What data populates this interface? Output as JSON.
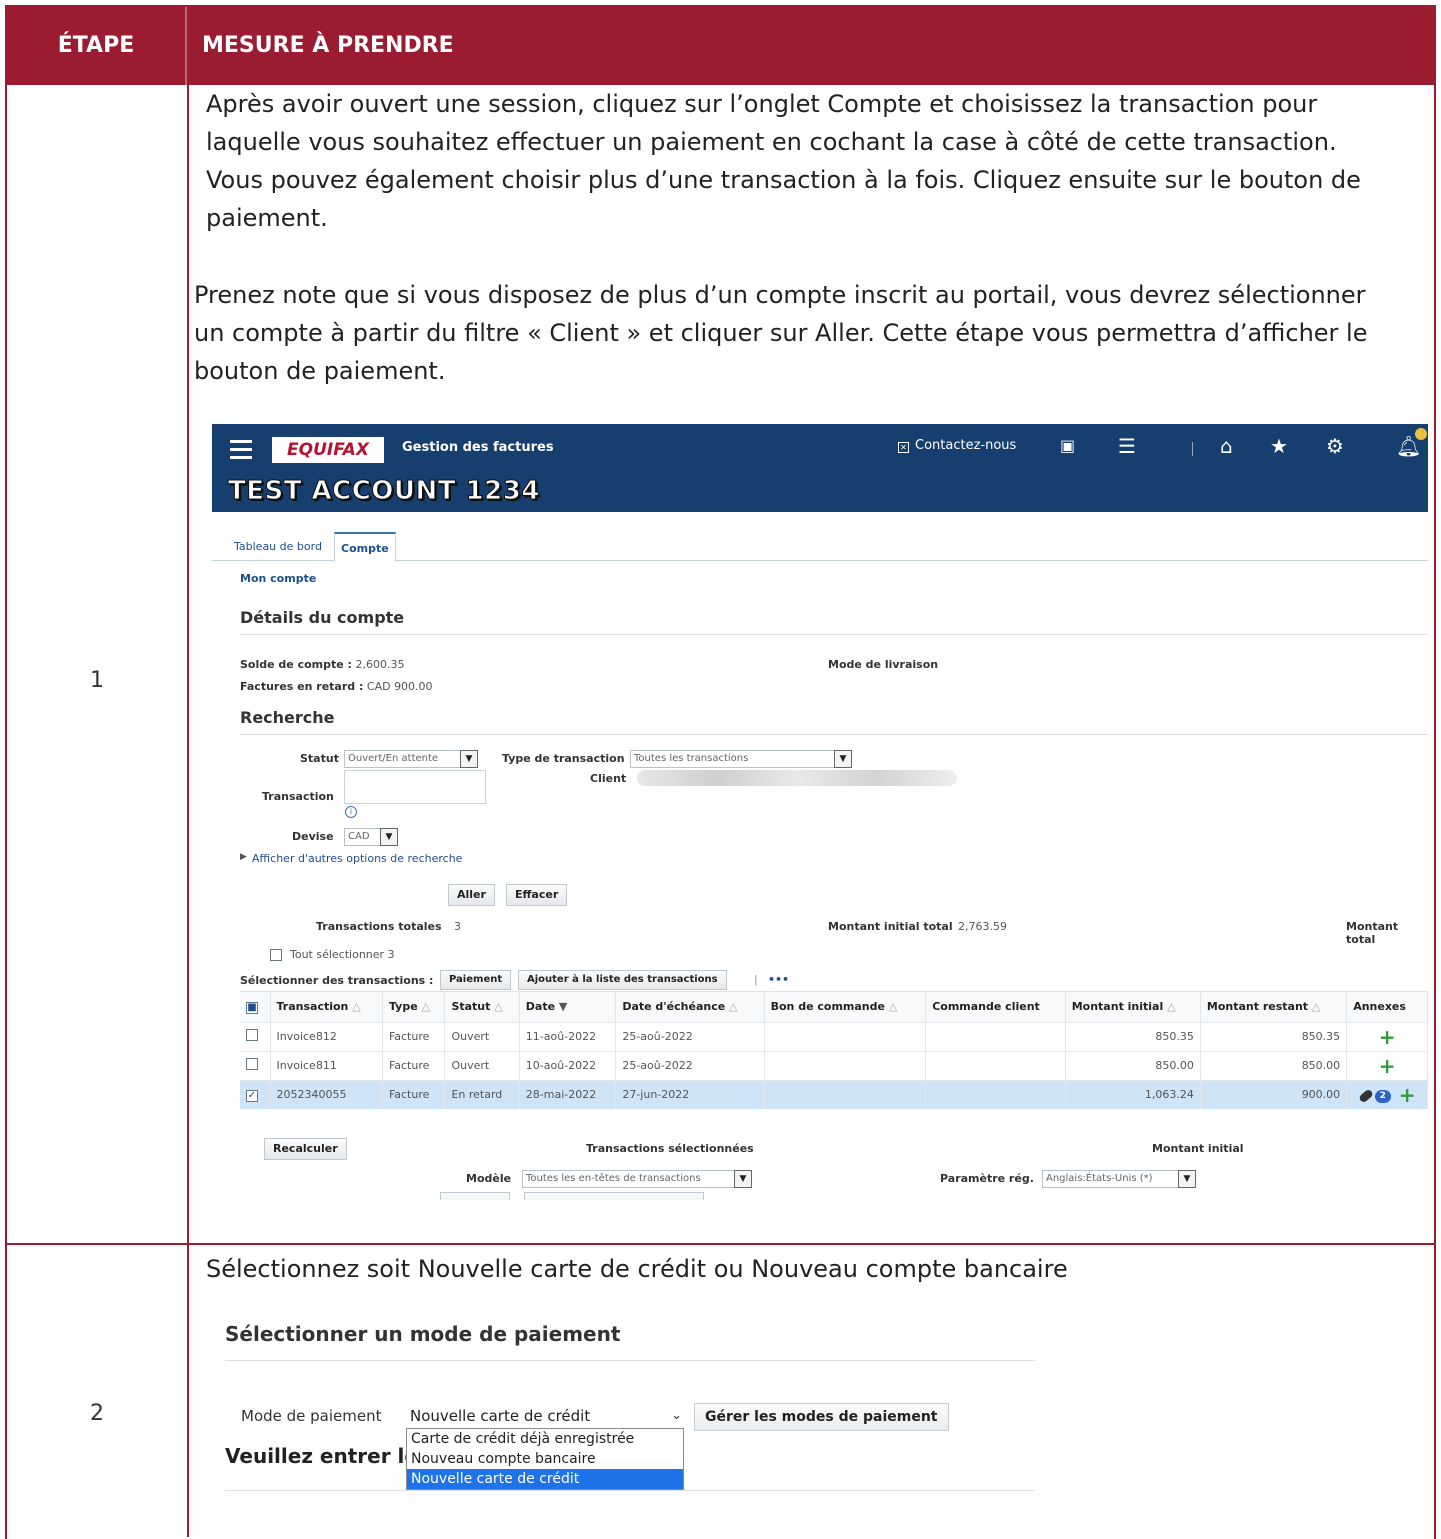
{
  "header": {
    "step_label": "ÉTAPE",
    "action_label": "MESURE À PRENDRE"
  },
  "steps": [
    {
      "number": "1",
      "paragraphs": [
        "Après avoir ouvert une session, cliquez sur l’onglet Compte et choisissez la transaction pour laquelle vous souhaitez effectuer un paiement en cochant la case à côté de cette transaction. Vous pouvez également choisir plus d’une transaction à la fois. Cliquez ensuite sur le bouton de paiement.",
        "Prenez note que si vous disposez de plus d’un compte inscrit au portail, vous devrez sélectionner un compte à partir du filtre « Client » et cliquer sur Aller. Cette étape vous permettra d’afficher le bouton de paiement."
      ]
    },
    {
      "number": "2",
      "paragraphs": [
        "Sélectionnez soit Nouvelle carte de crédit ou Nouveau compte bancaire"
      ]
    }
  ],
  "portal": {
    "logo": "EQUIFAX",
    "app_title": "Gestion des factures",
    "contact": "Contactez-nous",
    "account_name": "TEST ACCOUNT 1234",
    "icons": [
      "menu-icon",
      "search-doc-icon",
      "list-icon",
      "home-icon",
      "star-icon",
      "gear-icon",
      "bell-icon"
    ],
    "tabs": [
      "Tableau de bord",
      "Compte"
    ],
    "active_tab": "Compte",
    "breadcrumb": "Mon compte",
    "details_title": "Détails du compte",
    "balance_label": "Solde de compte :",
    "balance_value": "2,600.35",
    "overdue_label": "Factures en retard :",
    "overdue_value": "CAD 900.00",
    "delivery_label": "Mode de livraison",
    "search_title": "Recherche",
    "search": {
      "status_label": "Statut",
      "status_value": "Ouvert/En attente",
      "type_label": "Type de transaction",
      "type_value": "Toutes les transactions",
      "client_label": "Client",
      "transaction_label": "Transaction",
      "currency_label": "Devise",
      "currency_value": "CAD",
      "more_options": "Afficher d'autres options de recherche",
      "go_button": "Aller",
      "clear_button": "Effacer"
    },
    "totals": {
      "total_tx_label": "Transactions totales",
      "total_tx_value": "3",
      "initial_total_label": "Montant initial total",
      "initial_total_value": "2,763.59",
      "total_label": "Montant total"
    },
    "select_all": "Tout sélectionner 3",
    "select_tx_label": "Sélectionner des transactions :",
    "pay_button": "Paiement",
    "add_list_button": "Ajouter à la liste des transactions",
    "more_glyph": "•••",
    "columns": [
      "Transaction",
      "Type",
      "Statut",
      "Date",
      "Date d'échéance",
      "Bon de commande",
      "Commande client",
      "Montant initial",
      "Montant restant",
      "Annexes"
    ],
    "rows": [
      {
        "transaction": "Invoice812",
        "type": "Facture",
        "status": "Ouvert",
        "date": "11-aoû-2022",
        "due": "25-aoû-2022",
        "po": "",
        "order": "",
        "initial": "850.35",
        "remaining": "850.35",
        "attachments": "",
        "checked": false
      },
      {
        "transaction": "Invoice811",
        "type": "Facture",
        "status": "Ouvert",
        "date": "10-aoû-2022",
        "due": "25-aoû-2022",
        "po": "",
        "order": "",
        "initial": "850.00",
        "remaining": "850.00",
        "attachments": "",
        "checked": false
      },
      {
        "transaction": "2052340055",
        "type": "Facture",
        "status": "En retard",
        "date": "28-mai-2022",
        "due": "27-jun-2022",
        "po": "",
        "order": "",
        "initial": "1,063.24",
        "remaining": "900.00",
        "attachments": "2",
        "checked": true
      }
    ],
    "recalc_button": "Recalculer",
    "selected_tx_label": "Transactions sélectionnées",
    "initial_amount_label": "Montant initial",
    "model_label": "Modèle",
    "model_value": "Toutes les en-têtes de transactions",
    "region_label": "Paramètre rég.",
    "region_value": "Anglais:États-Unis (*)"
  },
  "payment_dialog": {
    "title": "Sélectionner un mode de paiement",
    "method_label": "Mode de paiement",
    "method_value": "Nouvelle carte de crédit",
    "manage_button": "Gérer les modes de paiement",
    "subtitle": "Veuillez entrer le",
    "options": [
      "Carte de crédit déjà enregistrée",
      "Nouveau compte bancaire",
      "Nouvelle carte de crédit"
    ],
    "highlighted_option": "Nouvelle carte de crédit"
  }
}
